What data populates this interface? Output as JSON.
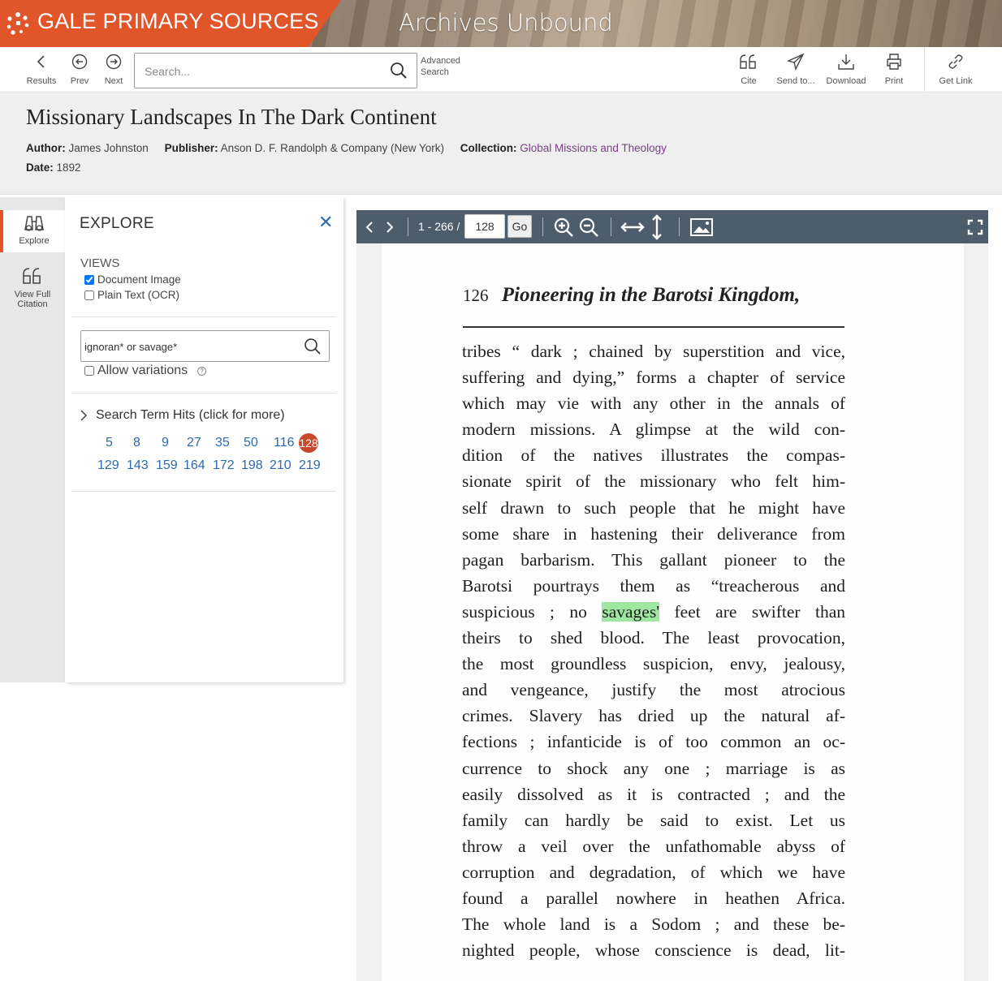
{
  "banner": {
    "brand": "GALE PRIMARY SOURCES",
    "product": "Archives Unbound"
  },
  "toolbar": {
    "results": "Results",
    "prev": "Prev",
    "next": "Next",
    "search_placeholder": "Search...",
    "advanced_search_line1": "Advanced",
    "advanced_search_line2": "Search",
    "cite": "Cite",
    "send_to": "Send to...",
    "download": "Download",
    "print": "Print",
    "get_link": "Get Link"
  },
  "document": {
    "title": "Missionary Landscapes In The Dark Continent",
    "author_label": "Author:",
    "author": "James Johnston",
    "publisher_label": "Publisher:",
    "publisher": "Anson D. F. Randolph & Company (New York)",
    "collection_label": "Collection:",
    "collection": "Global Missions and Theology",
    "date_label": "Date:",
    "date": "1892"
  },
  "rail": {
    "explore": "Explore",
    "view_full_line1": "View Full",
    "view_full_line2": "Citation"
  },
  "explore": {
    "title": "EXPLORE",
    "views_label": "VIEWS",
    "view_document_image": "Document Image",
    "view_document_image_checked": true,
    "view_plain_text": "Plain Text (OCR)",
    "view_plain_text_checked": false,
    "term_value": "ignoran* or savage*",
    "allow_variations": "Allow variations",
    "hits_heading": "Search Term Hits (click for more)",
    "hits_row1": [
      "5",
      "8",
      "9",
      "27",
      "35",
      "50",
      "116",
      "128"
    ],
    "hits_row2": [
      "129",
      "143",
      "159",
      "164",
      "172",
      "198",
      "210",
      "219"
    ],
    "current_hit": "128"
  },
  "viewer": {
    "page_range": "1 - 266 /",
    "page_value": "128",
    "go": "Go"
  },
  "page": {
    "number": "126",
    "running_title": "Pioneering in the Barotsi Kingdom,",
    "lines": [
      "tribes “ dark ; chained by superstition and vice,",
      "suffering and dying,” forms a chapter of service",
      "which may vie with any other in the annals of",
      "modern missions. A glimpse at the wild con-",
      "dition of the natives illustrates the compas-",
      "sionate spirit of the missionary who felt him-",
      "self drawn to such people that he might have",
      "some share in hastening their deliverance from",
      "pagan barbarism. This gallant pioneer to the",
      "Barotsi pourtrays them as “treacherous and",
      "suspicious ; no ",
      "theirs to shed blood. The least provocation,",
      "the most groundless suspicion, envy, jealousy,",
      "and vengeance, justify the most atrocious",
      "crimes. Slavery has dried up the natural af-",
      "fections ; infanticide is of too common an oc-",
      "currence to shock any one ; marriage is as",
      "easily dissolved as it is contracted ; and the",
      "family can hardly be said to exist. Let us",
      "throw a veil over the unfathomable abyss of",
      "corruption and degradation, of which we have",
      "found a parallel nowhere in heathen Africa.",
      "The whole land is a Sodom ; and these be-",
      "nighted people, whose conscience is dead, lit-"
    ],
    "highlight_word": "savages'",
    "highlight_rest": " feet are swifter than"
  }
}
